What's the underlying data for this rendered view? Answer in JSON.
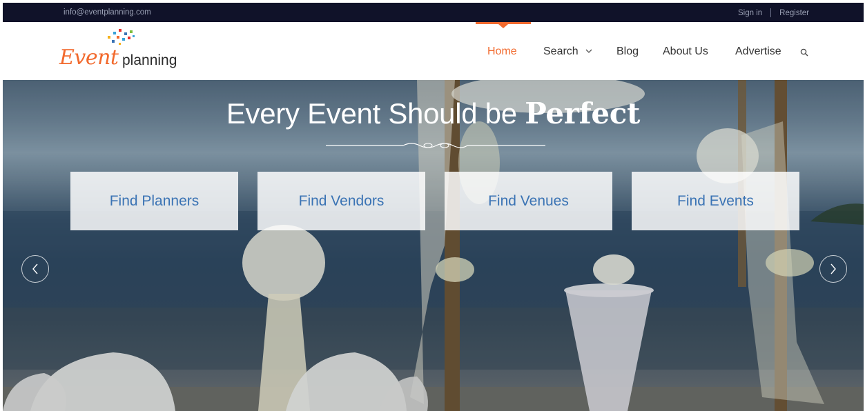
{
  "topbar": {
    "email": "info@eventplanning.com",
    "sign_in": "Sign in",
    "register": "Register"
  },
  "logo": {
    "event": "Event",
    "planning": "planning"
  },
  "nav": {
    "home": "Home",
    "search": "Search",
    "blog": "Blog",
    "about": "About Us",
    "advertise": "Advertise"
  },
  "hero": {
    "title_prefix": "Every Event Should be",
    "title_emphasis": "Perfect"
  },
  "categories": {
    "planners": "Find Planners",
    "vendors": "Find Vendors",
    "venues": "Find Venues",
    "events": "Find Events"
  },
  "icons": {
    "search": "search-icon",
    "chevron": "chevron-down-icon",
    "prev": "chevron-left-icon",
    "next": "chevron-right-icon"
  },
  "colors": {
    "accent": "#f26a2e",
    "link_blue": "#3a73b4",
    "topbar_bg": "#101229"
  }
}
